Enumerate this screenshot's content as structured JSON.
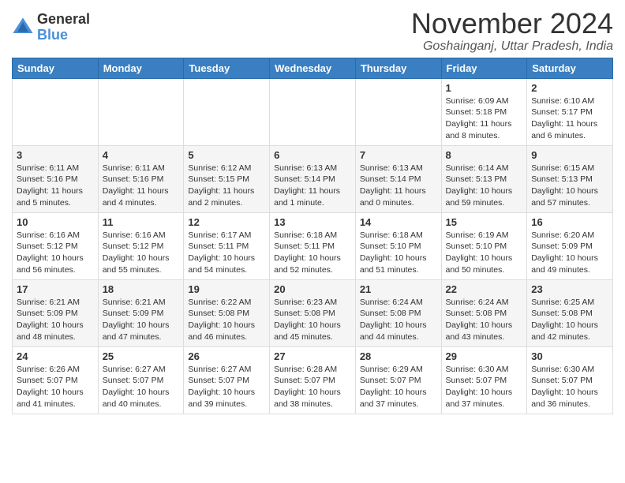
{
  "logo": {
    "general": "General",
    "blue": "Blue"
  },
  "title": "November 2024",
  "subtitle": "Goshainganj, Uttar Pradesh, India",
  "headers": [
    "Sunday",
    "Monday",
    "Tuesday",
    "Wednesday",
    "Thursday",
    "Friday",
    "Saturday"
  ],
  "weeks": [
    [
      {
        "day": "",
        "info": ""
      },
      {
        "day": "",
        "info": ""
      },
      {
        "day": "",
        "info": ""
      },
      {
        "day": "",
        "info": ""
      },
      {
        "day": "",
        "info": ""
      },
      {
        "day": "1",
        "info": "Sunrise: 6:09 AM\nSunset: 5:18 PM\nDaylight: 11 hours\nand 8 minutes."
      },
      {
        "day": "2",
        "info": "Sunrise: 6:10 AM\nSunset: 5:17 PM\nDaylight: 11 hours\nand 6 minutes."
      }
    ],
    [
      {
        "day": "3",
        "info": "Sunrise: 6:11 AM\nSunset: 5:16 PM\nDaylight: 11 hours\nand 5 minutes."
      },
      {
        "day": "4",
        "info": "Sunrise: 6:11 AM\nSunset: 5:16 PM\nDaylight: 11 hours\nand 4 minutes."
      },
      {
        "day": "5",
        "info": "Sunrise: 6:12 AM\nSunset: 5:15 PM\nDaylight: 11 hours\nand 2 minutes."
      },
      {
        "day": "6",
        "info": "Sunrise: 6:13 AM\nSunset: 5:14 PM\nDaylight: 11 hours\nand 1 minute."
      },
      {
        "day": "7",
        "info": "Sunrise: 6:13 AM\nSunset: 5:14 PM\nDaylight: 11 hours\nand 0 minutes."
      },
      {
        "day": "8",
        "info": "Sunrise: 6:14 AM\nSunset: 5:13 PM\nDaylight: 10 hours\nand 59 minutes."
      },
      {
        "day": "9",
        "info": "Sunrise: 6:15 AM\nSunset: 5:13 PM\nDaylight: 10 hours\nand 57 minutes."
      }
    ],
    [
      {
        "day": "10",
        "info": "Sunrise: 6:16 AM\nSunset: 5:12 PM\nDaylight: 10 hours\nand 56 minutes."
      },
      {
        "day": "11",
        "info": "Sunrise: 6:16 AM\nSunset: 5:12 PM\nDaylight: 10 hours\nand 55 minutes."
      },
      {
        "day": "12",
        "info": "Sunrise: 6:17 AM\nSunset: 5:11 PM\nDaylight: 10 hours\nand 54 minutes."
      },
      {
        "day": "13",
        "info": "Sunrise: 6:18 AM\nSunset: 5:11 PM\nDaylight: 10 hours\nand 52 minutes."
      },
      {
        "day": "14",
        "info": "Sunrise: 6:18 AM\nSunset: 5:10 PM\nDaylight: 10 hours\nand 51 minutes."
      },
      {
        "day": "15",
        "info": "Sunrise: 6:19 AM\nSunset: 5:10 PM\nDaylight: 10 hours\nand 50 minutes."
      },
      {
        "day": "16",
        "info": "Sunrise: 6:20 AM\nSunset: 5:09 PM\nDaylight: 10 hours\nand 49 minutes."
      }
    ],
    [
      {
        "day": "17",
        "info": "Sunrise: 6:21 AM\nSunset: 5:09 PM\nDaylight: 10 hours\nand 48 minutes."
      },
      {
        "day": "18",
        "info": "Sunrise: 6:21 AM\nSunset: 5:09 PM\nDaylight: 10 hours\nand 47 minutes."
      },
      {
        "day": "19",
        "info": "Sunrise: 6:22 AM\nSunset: 5:08 PM\nDaylight: 10 hours\nand 46 minutes."
      },
      {
        "day": "20",
        "info": "Sunrise: 6:23 AM\nSunset: 5:08 PM\nDaylight: 10 hours\nand 45 minutes."
      },
      {
        "day": "21",
        "info": "Sunrise: 6:24 AM\nSunset: 5:08 PM\nDaylight: 10 hours\nand 44 minutes."
      },
      {
        "day": "22",
        "info": "Sunrise: 6:24 AM\nSunset: 5:08 PM\nDaylight: 10 hours\nand 43 minutes."
      },
      {
        "day": "23",
        "info": "Sunrise: 6:25 AM\nSunset: 5:08 PM\nDaylight: 10 hours\nand 42 minutes."
      }
    ],
    [
      {
        "day": "24",
        "info": "Sunrise: 6:26 AM\nSunset: 5:07 PM\nDaylight: 10 hours\nand 41 minutes."
      },
      {
        "day": "25",
        "info": "Sunrise: 6:27 AM\nSunset: 5:07 PM\nDaylight: 10 hours\nand 40 minutes."
      },
      {
        "day": "26",
        "info": "Sunrise: 6:27 AM\nSunset: 5:07 PM\nDaylight: 10 hours\nand 39 minutes."
      },
      {
        "day": "27",
        "info": "Sunrise: 6:28 AM\nSunset: 5:07 PM\nDaylight: 10 hours\nand 38 minutes."
      },
      {
        "day": "28",
        "info": "Sunrise: 6:29 AM\nSunset: 5:07 PM\nDaylight: 10 hours\nand 37 minutes."
      },
      {
        "day": "29",
        "info": "Sunrise: 6:30 AM\nSunset: 5:07 PM\nDaylight: 10 hours\nand 37 minutes."
      },
      {
        "day": "30",
        "info": "Sunrise: 6:30 AM\nSunset: 5:07 PM\nDaylight: 10 hours\nand 36 minutes."
      }
    ]
  ]
}
